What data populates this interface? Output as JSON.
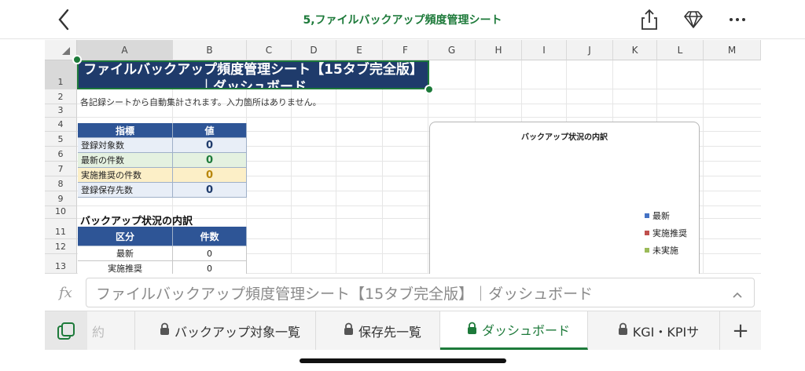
{
  "header": {
    "title": "5,ファイルバックアップ頻度管理シート",
    "accent_color": "#1d7a3a",
    "icons": [
      "back-chevron-icon",
      "share-icon",
      "diamond-icon",
      "more-icon"
    ]
  },
  "grid": {
    "columns": [
      "A",
      "B",
      "C",
      "D",
      "E",
      "F",
      "G",
      "H",
      "I",
      "J",
      "K",
      "L",
      "M"
    ],
    "rows": [
      "1",
      "2",
      "3",
      "4",
      "5",
      "6",
      "7",
      "8",
      "9",
      "10",
      "11",
      "12",
      "13"
    ],
    "title_cell": "ファイルバックアップ頻度管理シート【15タブ完全版】｜ダッシュボード",
    "note": "各記録シートから自動集計されます。入力箇所はありません。",
    "kpi_table": {
      "headers": [
        "指標",
        "値"
      ],
      "rows": [
        {
          "label": "登録対象数",
          "value": "0",
          "color": "#1f3b6b",
          "bg": "#e8eef7"
        },
        {
          "label": "最新の件数",
          "value": "0",
          "color": "#1d7a3a",
          "bg": "#e4f1e0"
        },
        {
          "label": "実施推奨の件数",
          "value": "0",
          "color": "#b8860b",
          "bg": "#fcefc7"
        },
        {
          "label": "登録保存先数",
          "value": "0",
          "color": "#1f3b6b",
          "bg": "#e8eef7"
        }
      ]
    },
    "section_title": "バックアップ状況の内訳",
    "breakdown_table": {
      "headers": [
        "区分",
        "件数"
      ],
      "rows": [
        {
          "label": "最新",
          "value": "0"
        },
        {
          "label": "実施推奨",
          "value": "0"
        }
      ]
    }
  },
  "chart": {
    "title": "バックアップ状況の内訳",
    "legend": [
      {
        "label": "最新",
        "color": "#4472c4"
      },
      {
        "label": "実施推奨",
        "color": "#c0504d"
      },
      {
        "label": "未実施",
        "color": "#9bbb59"
      }
    ]
  },
  "formula_bar": {
    "fx_label": "fx",
    "value": "ファイルバックアップ頻度管理シート【15タブ完全版】｜ダッシュボード"
  },
  "tabs": {
    "items": [
      {
        "label": "約",
        "locked": false,
        "active": false
      },
      {
        "label": "バックアップ対象一覧",
        "locked": true,
        "active": false
      },
      {
        "label": "保存先一覧",
        "locked": true,
        "active": false
      },
      {
        "label": "ダッシュボード",
        "locked": true,
        "active": true
      },
      {
        "label": "KGI・KPIサ",
        "locked": true,
        "active": false
      }
    ],
    "add_label": "+"
  }
}
